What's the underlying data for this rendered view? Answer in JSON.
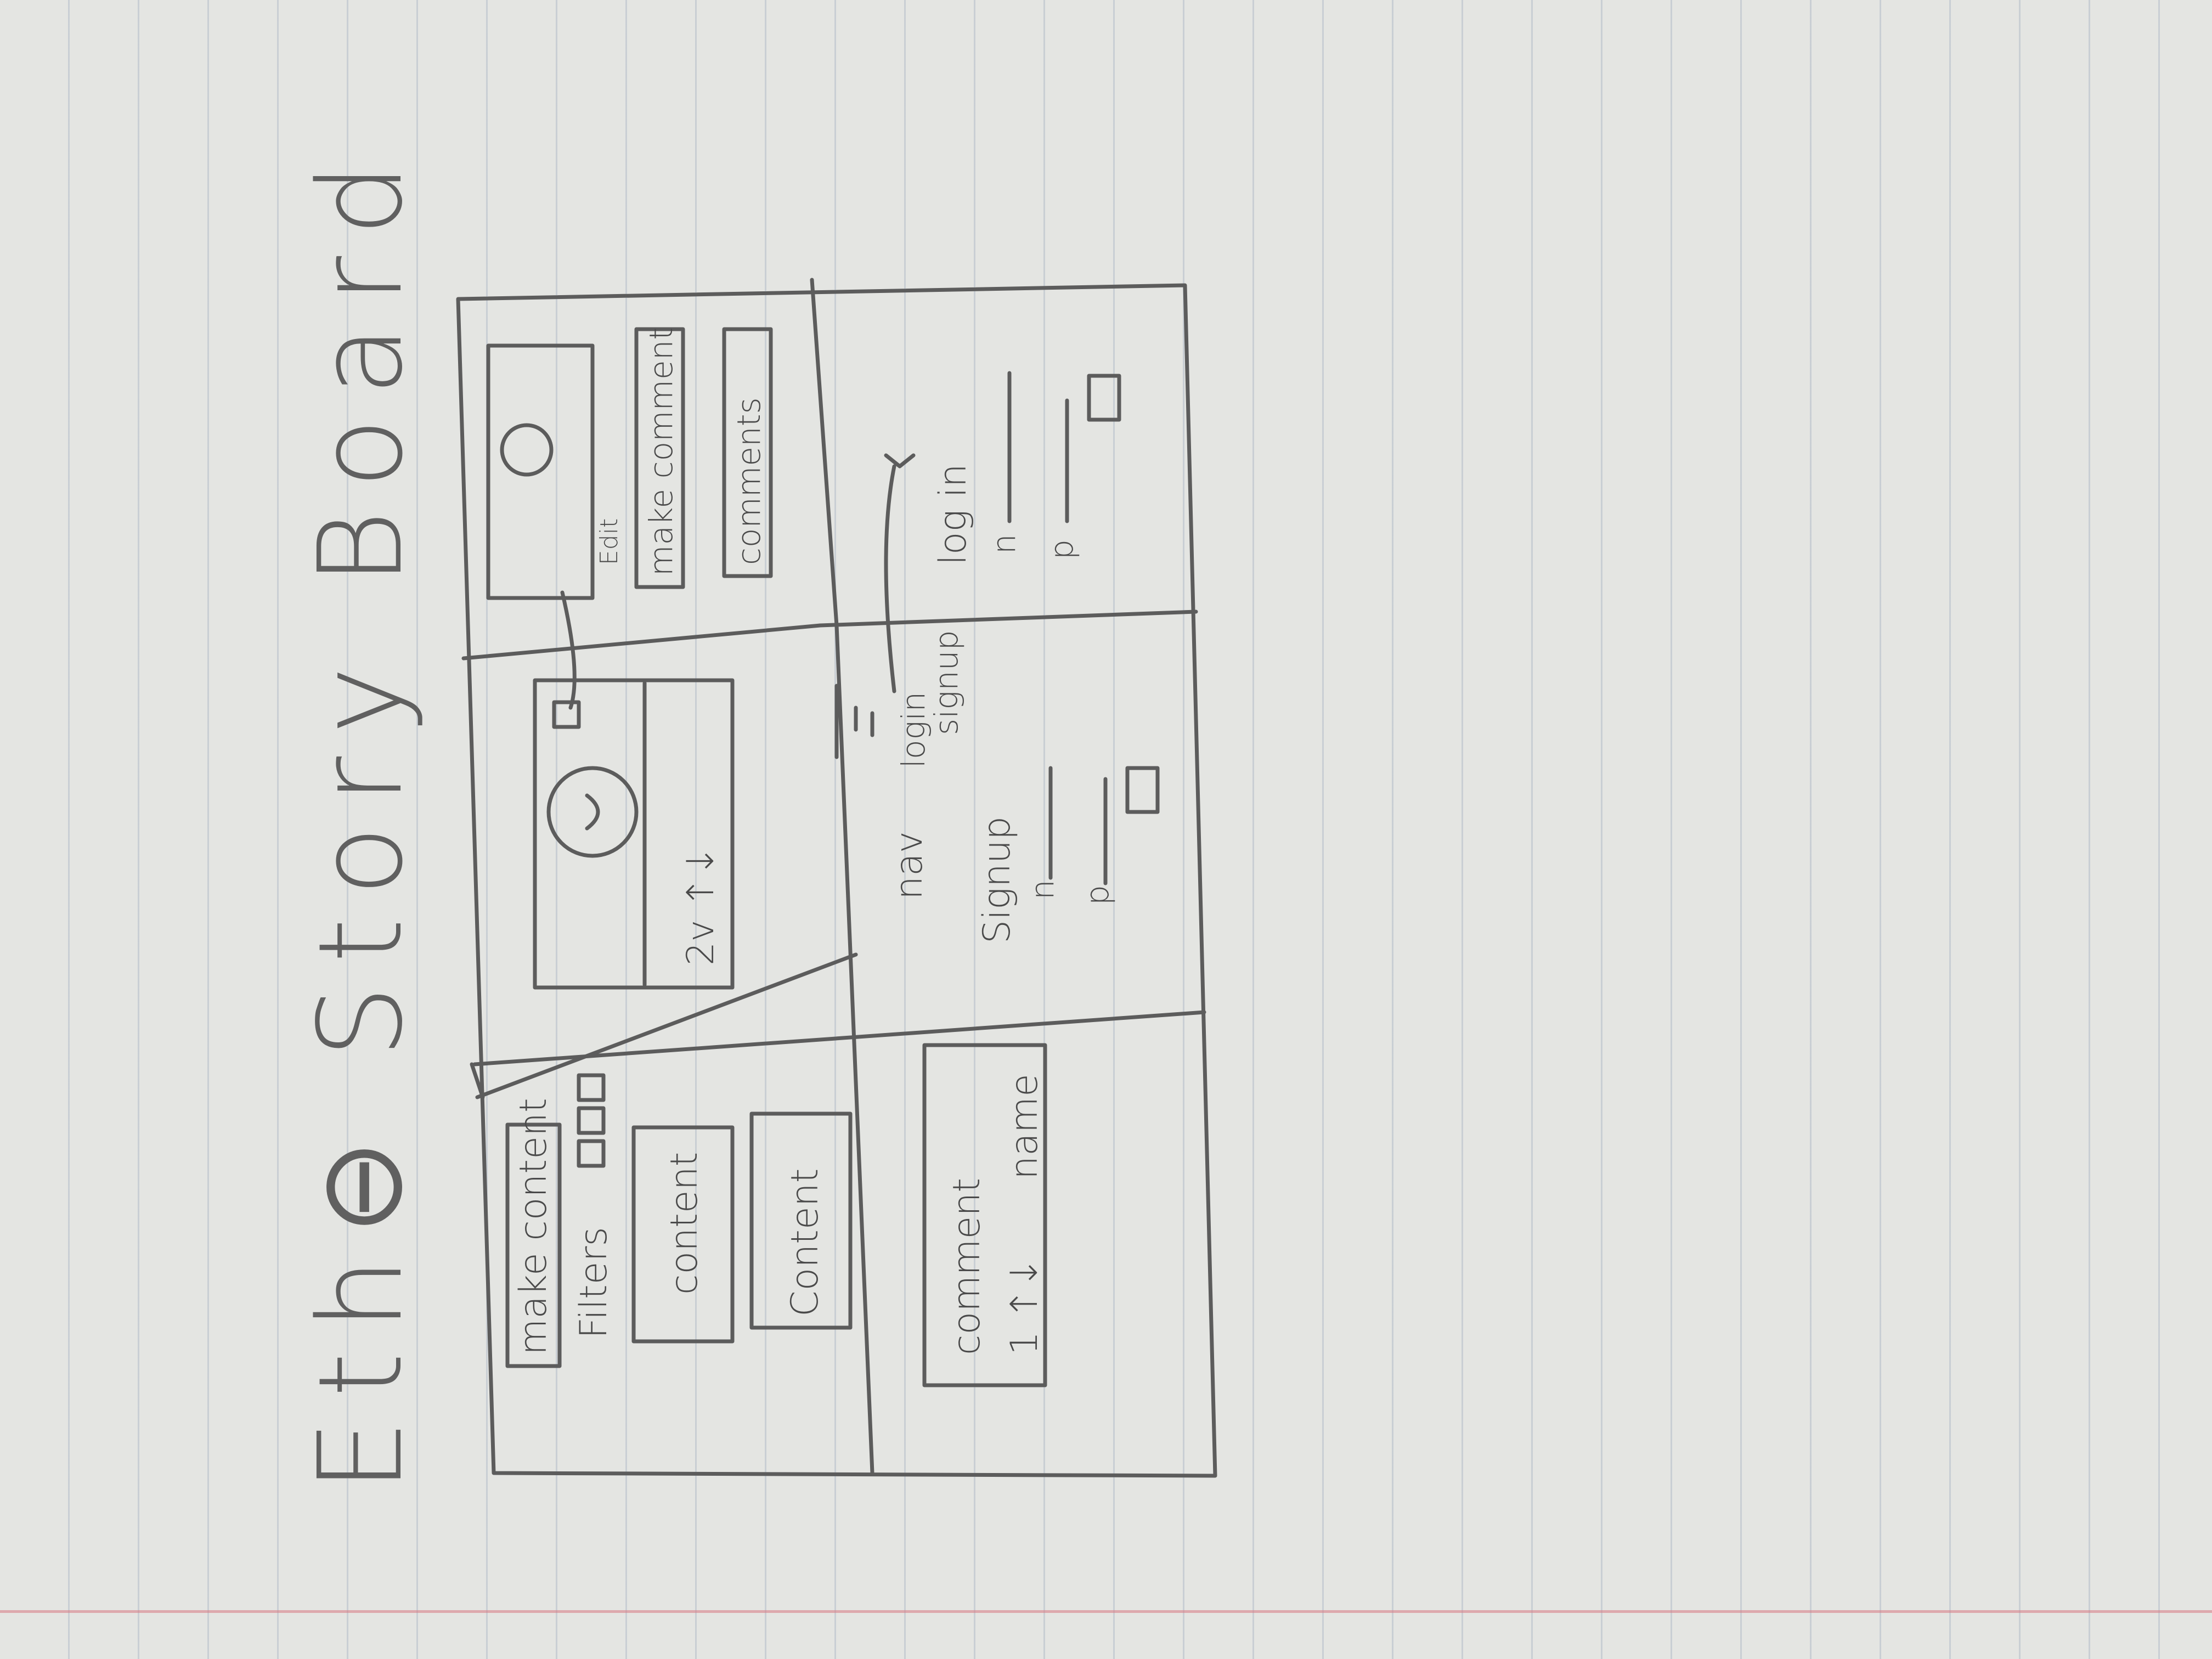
{
  "title": "Eth⊖ Story Board",
  "panels": {
    "feed": {
      "make_content": "make content",
      "filters": "Filters",
      "content_1": "content",
      "content_2": "Content"
    },
    "post_view": {
      "votes": "2v ↑↓"
    },
    "post_detail": {
      "edit": "Edit",
      "make_comment": "make comment",
      "comments": "comments"
    },
    "comment_view": {
      "comment": "comment",
      "name": "name",
      "votes": "1 ↑↓"
    },
    "nav_signup": {
      "nav": "nav",
      "login": "login",
      "signup_link": "signup",
      "signup_heading": "Signup",
      "n": "n",
      "p": "p"
    },
    "login": {
      "heading": "log in",
      "n": "n",
      "p": "p"
    }
  },
  "colors": {
    "pencil": "#5c5c5c",
    "paper": "#e4e5e2",
    "margin_line": "#d7868f"
  }
}
